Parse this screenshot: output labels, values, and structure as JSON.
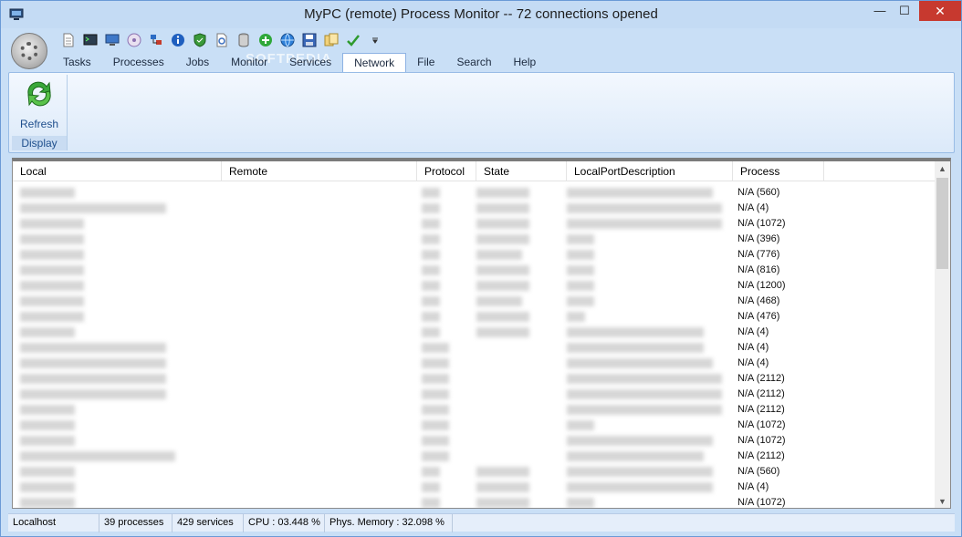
{
  "window": {
    "title": "MyPC (remote) Process Monitor -- 72 connections opened",
    "min_glyph": "—",
    "max_glyph": "☐",
    "close_glyph": "✕"
  },
  "quick_access": [
    "new-doc-icon",
    "terminal-icon",
    "monitor-icon",
    "disc-icon",
    "network-users-icon",
    "info-icon",
    "shield-icon",
    "document-settings-icon",
    "database-icon",
    "add-icon",
    "globe-icon",
    "save-icon",
    "folders-icon",
    "checkmark-icon",
    "dropdown-icon"
  ],
  "watermark": "SOFTPEDIA",
  "tabs": [
    {
      "label": "Tasks",
      "active": false
    },
    {
      "label": "Processes",
      "active": false
    },
    {
      "label": "Jobs",
      "active": false
    },
    {
      "label": "Monitor",
      "active": false
    },
    {
      "label": "Services",
      "active": false
    },
    {
      "label": "Network",
      "active": true
    },
    {
      "label": "File",
      "active": false
    },
    {
      "label": "Search",
      "active": false
    },
    {
      "label": "Help",
      "active": false
    }
  ],
  "ribbon": {
    "refresh_label": "Refresh",
    "group_label": "Display"
  },
  "list": {
    "columns": [
      "Local",
      "Remote",
      "Protocol",
      "State",
      "LocalPortDescription",
      "Process"
    ],
    "processes": [
      "N/A (560)",
      "N/A (4)",
      "N/A (1072)",
      "N/A (396)",
      "N/A (776)",
      "N/A (816)",
      "N/A (1200)",
      "N/A (468)",
      "N/A (476)",
      "N/A (4)",
      "N/A (4)",
      "N/A (4)",
      "N/A (2112)",
      "N/A (2112)",
      "N/A (2112)",
      "N/A (1072)",
      "N/A (1072)",
      "N/A (2112)",
      "N/A (560)",
      "N/A (4)",
      "N/A (1072)"
    ]
  },
  "status": {
    "host": "Localhost",
    "processes": "39 processes",
    "services": "429 services",
    "cpu": "CPU : 03.448 %",
    "memory": "Phys. Memory : 32.098 %"
  },
  "colors": {
    "accent": "#c7392f",
    "ribbon_text": "#1e4e8c",
    "window_frame": "#c9dff6"
  }
}
